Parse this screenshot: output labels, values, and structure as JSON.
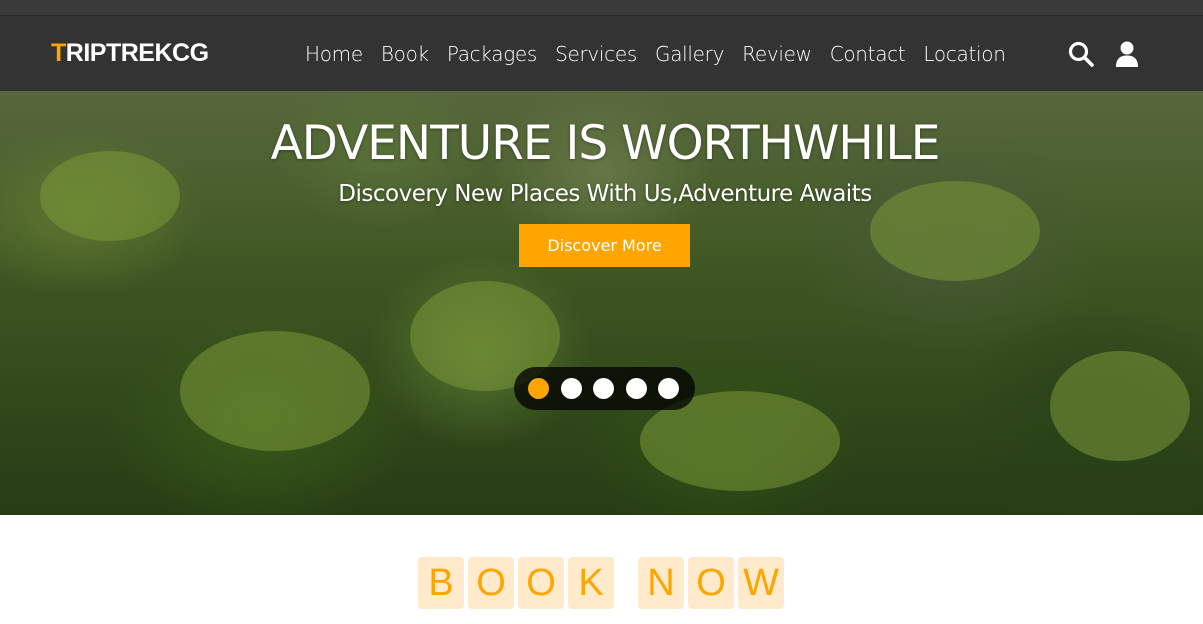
{
  "logo": {
    "first": "T",
    "rest": "RIPTREKCG"
  },
  "nav": {
    "items": [
      "Home",
      "Book",
      "Packages",
      "Services",
      "Gallery",
      "Review",
      "Contact",
      "Location"
    ]
  },
  "icons": {
    "search": "search-icon",
    "user": "user-icon"
  },
  "hero": {
    "title": "ADVENTURE IS WORTHWHILE",
    "subtitle": "Discovery New Places With Us,Adventure Awaits",
    "button": "Discover More",
    "slides": 5,
    "active_slide": 1
  },
  "book": {
    "word1": [
      "B",
      "O",
      "O",
      "K"
    ],
    "word2": [
      "N",
      "O",
      "W"
    ]
  },
  "colors": {
    "accent": "#ffa500",
    "navbar": "#333333",
    "letter_bg": "#ffebcc"
  }
}
